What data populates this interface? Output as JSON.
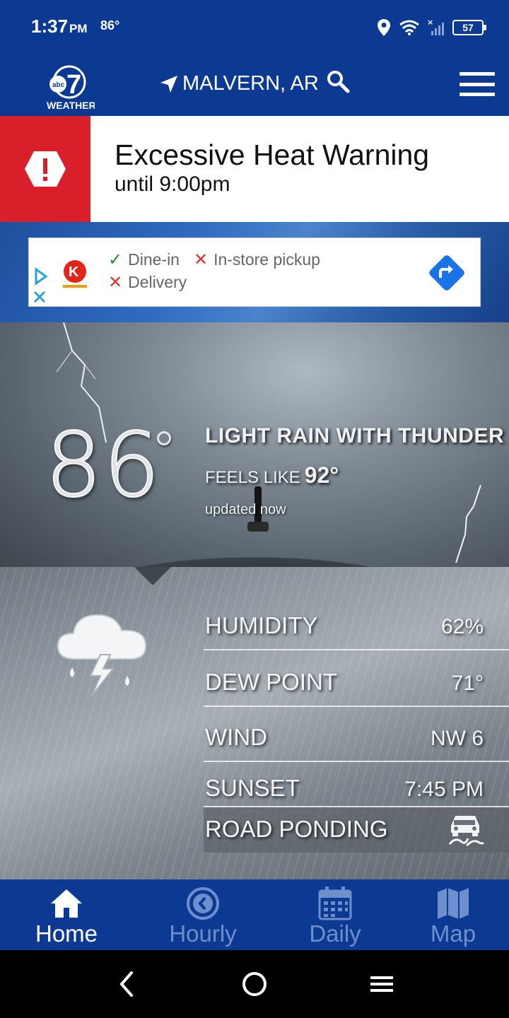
{
  "status_bar": {
    "time": "1:37",
    "ampm": "PM",
    "temp": "86°",
    "battery": "57"
  },
  "header": {
    "logo_text": "WEATHER",
    "location": "MALVERN, AR"
  },
  "alert": {
    "title": "Excessive Heat Warning",
    "subtitle": "until 9:00pm"
  },
  "ad": {
    "brand_letter": "K",
    "features": [
      {
        "icon": "check-icon",
        "label": "Dine-in"
      },
      {
        "icon": "x-icon",
        "label": "In-store pickup"
      },
      {
        "icon": "x-icon",
        "label": "Delivery"
      }
    ]
  },
  "current": {
    "temperature": "86",
    "condition": "LIGHT RAIN WITH THUNDER",
    "feels_like_label": "FEELS LIKE",
    "feels_like_value": "92°",
    "updated": "updated now",
    "icon": "thunderstorm-icon"
  },
  "details": [
    {
      "label": "HUMIDITY",
      "value": "62%"
    },
    {
      "label": "DEW POINT",
      "value": "71°"
    },
    {
      "label": "WIND",
      "value": "NW 6"
    },
    {
      "label": "SUNSET",
      "value": "7:45 PM"
    }
  ],
  "road": {
    "label": "ROAD PONDING",
    "icon": "slippery-road-icon"
  },
  "bottom_nav": [
    {
      "label": "Home",
      "icon": "home-icon",
      "active": true
    },
    {
      "label": "Hourly",
      "icon": "clock-icon",
      "active": false
    },
    {
      "label": "Daily",
      "icon": "calendar-icon",
      "active": false
    },
    {
      "label": "Map",
      "icon": "map-icon",
      "active": false
    }
  ],
  "colors": {
    "brand_blue": "#0c3a93",
    "alert_red": "#d91f2a",
    "inactive_nav": "#6f8fcc"
  }
}
